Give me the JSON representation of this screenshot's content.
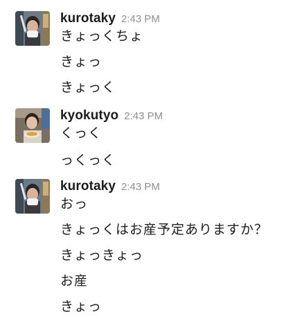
{
  "messages": [
    {
      "username": "kurotaky",
      "time": "2:43 PM",
      "avatar_icon": "user-avatar-eating-icon",
      "lines": [
        "きょっくちょ",
        "きょっ",
        "きょっく"
      ]
    },
    {
      "username": "kyokutyo",
      "time": "2:43 PM",
      "avatar_icon": "user-avatar-food-icon",
      "lines": [
        "くっく",
        "っくっく"
      ]
    },
    {
      "username": "kurotaky",
      "time": "2:43 PM",
      "avatar_icon": "user-avatar-eating-icon",
      "lines": [
        "おっ",
        "きょっくはお産予定ありますか？",
        "きょっきょっ",
        "お産",
        "きょっ"
      ]
    }
  ]
}
